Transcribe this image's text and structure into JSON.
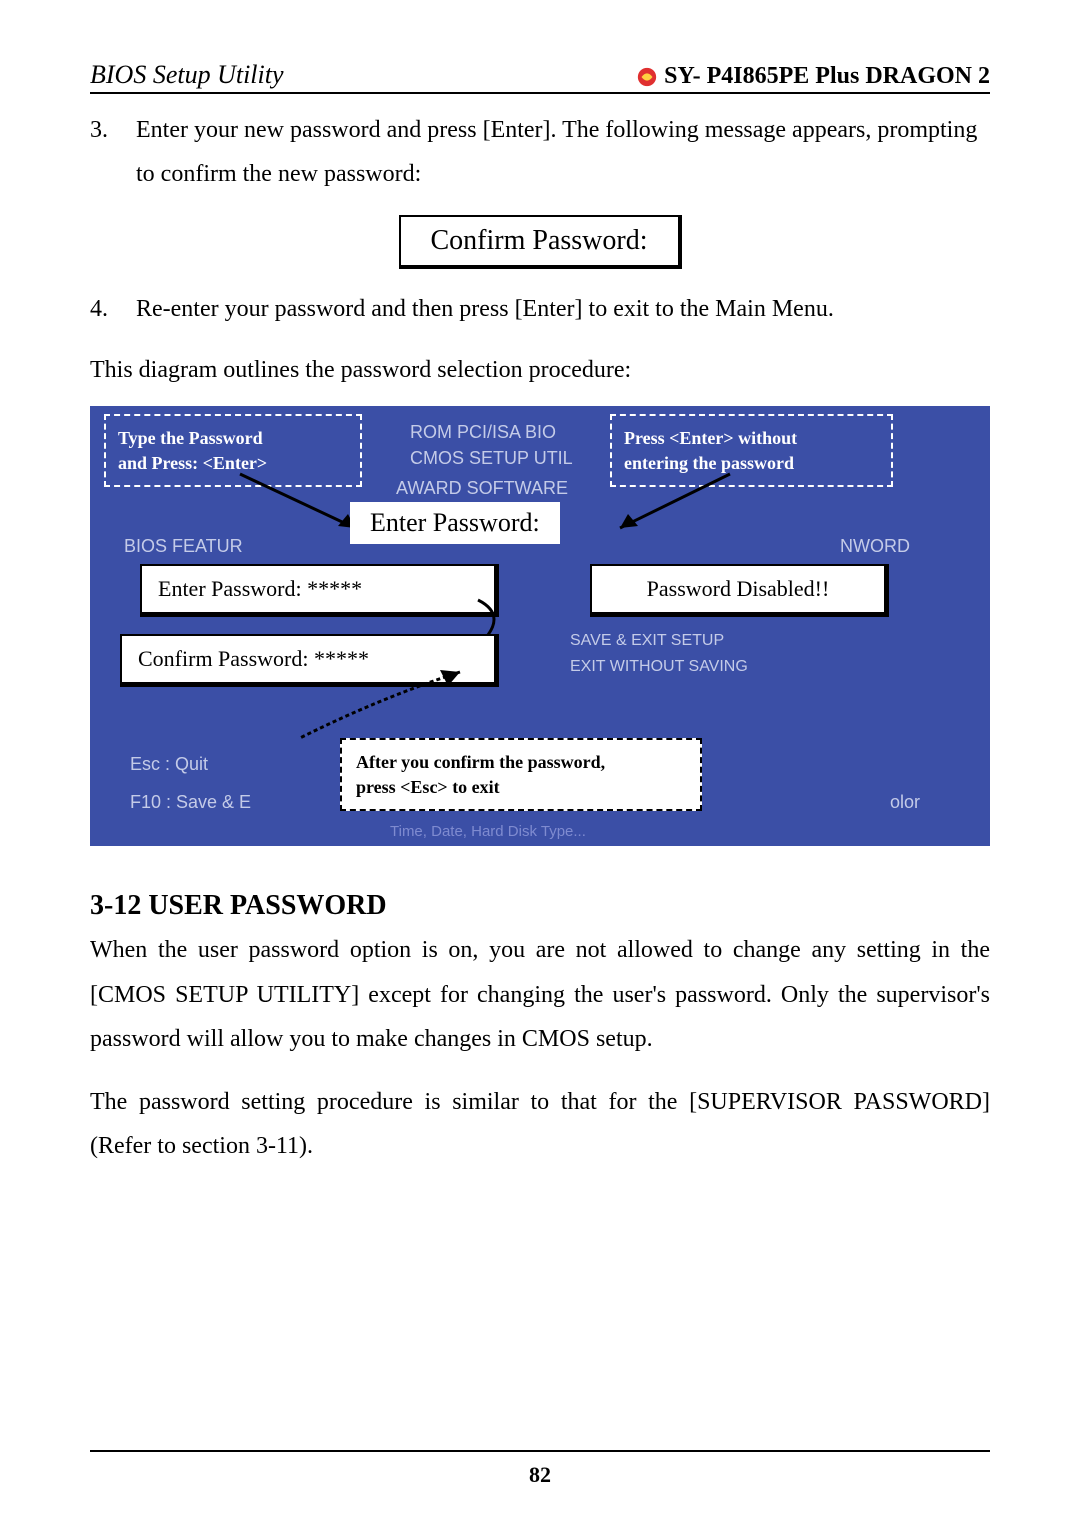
{
  "header": {
    "left": "BIOS Setup Utility",
    "right": "SY- P4I865PE Plus DRAGON 2"
  },
  "steps": {
    "s3_num": "3.",
    "s3_text": "Enter your new password and press [Enter]. The following message appears, prompting to confirm the new password:",
    "confirm_box": "Confirm Password:",
    "s4_num": "4.",
    "s4_text": "Re-enter your password and then press [Enter] to exit to the Main Menu."
  },
  "intro_diagram": "This diagram outlines the password selection procedure:",
  "diagram": {
    "type_pw": "Type the Password\nand Press: <Enter>",
    "press_enter": "Press <Enter> without\nentering the password",
    "rom": "ROM PCI/ISA BIO",
    "cmos": "CMOS SETUP UTIL",
    "award": "AWARD SOFTWARE",
    "enter_pw_header": "Enter Password:",
    "bios_feat": "BIOS FEATUR",
    "enter_pw": "Enter Password: *****",
    "confirm_pw": "Confirm Password: *****",
    "pw_disabled": "Password Disabled!!",
    "save_exit": "SAVE & EXIT SETUP",
    "exit_no_save": "EXIT WITHOUT SAVING",
    "esc": "Esc  : Quit",
    "f10": "F10  : Save & E",
    "color": "olor",
    "nword": "NWORD",
    "after_confirm": "After you confirm the password,\npress <Esc> to exit",
    "time_date": "Time, Date, Hard Disk Type..."
  },
  "section": {
    "heading": "3-12 USER PASSWORD",
    "p1": "When the user password option is on, you are not allowed to change any setting in the [CMOS SETUP UTILITY] except for changing the user's password. Only the supervisor's password will allow you to make changes in CMOS setup.",
    "p2": "The password setting procedure is similar to that for the [SUPERVISOR PASSWORD] (Refer to section 3-11)."
  },
  "footer": {
    "page": "82"
  }
}
